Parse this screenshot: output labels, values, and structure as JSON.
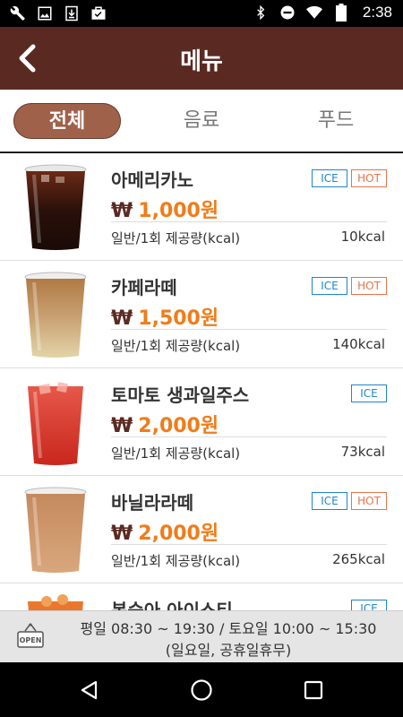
{
  "status_bar": {
    "time": "2:38",
    "left_icons": [
      "wrench-icon",
      "image-icon",
      "download-icon",
      "briefcase-check-icon"
    ],
    "right_icons": [
      "bluetooth-icon",
      "do-not-disturb-icon",
      "wifi-icon",
      "battery-icon"
    ]
  },
  "header": {
    "title": "메뉴",
    "back_icon": "chevron-left-icon",
    "color": "#5a2a22"
  },
  "tabs": [
    {
      "label": "전체",
      "active": true
    },
    {
      "label": "음료",
      "active": false
    },
    {
      "label": "푸드",
      "active": false
    }
  ],
  "menu": {
    "items": [
      {
        "name": "아메리카노",
        "currency": "₩",
        "price": "1,000원",
        "kcal_label": "일반/1회 제공량(kcal)",
        "kcal": "10kcal",
        "badges": [
          "ICE",
          "HOT"
        ]
      },
      {
        "name": "카페라떼",
        "currency": "₩",
        "price": "1,500원",
        "kcal_label": "일반/1회 제공량(kcal)",
        "kcal": "140kcal",
        "badges": [
          "ICE",
          "HOT"
        ]
      },
      {
        "name": "토마토 생과일주스",
        "currency": "₩",
        "price": "2,000원",
        "kcal_label": "일반/1회 제공량(kcal)",
        "kcal": "73kcal",
        "badges": [
          "ICE"
        ]
      },
      {
        "name": "바닐라라떼",
        "currency": "₩",
        "price": "2,000원",
        "kcal_label": "일반/1회 제공량(kcal)",
        "kcal": "265kcal",
        "badges": [
          "ICE",
          "HOT"
        ]
      },
      {
        "name": "복숭아 아이스티",
        "currency": "",
        "price": "",
        "kcal_label": "",
        "kcal": "",
        "badges": [
          "ICE"
        ]
      }
    ]
  },
  "hours": {
    "line1": "평일 08:30 ~ 19:30 / 토요일 10:00 ~ 15:30",
    "line2": "(일요일, 공휴일휴무)",
    "sign_text": "OPEN"
  },
  "nav": {
    "icons": [
      "back-triangle-icon",
      "home-circle-icon",
      "recents-square-icon"
    ]
  },
  "colors": {
    "header_brown": "#5a2a22",
    "tab_active": "#a0614b",
    "price_orange": "#f07c1a",
    "ice_blue": "#1f86c8",
    "hot_orange": "#e8734a"
  }
}
